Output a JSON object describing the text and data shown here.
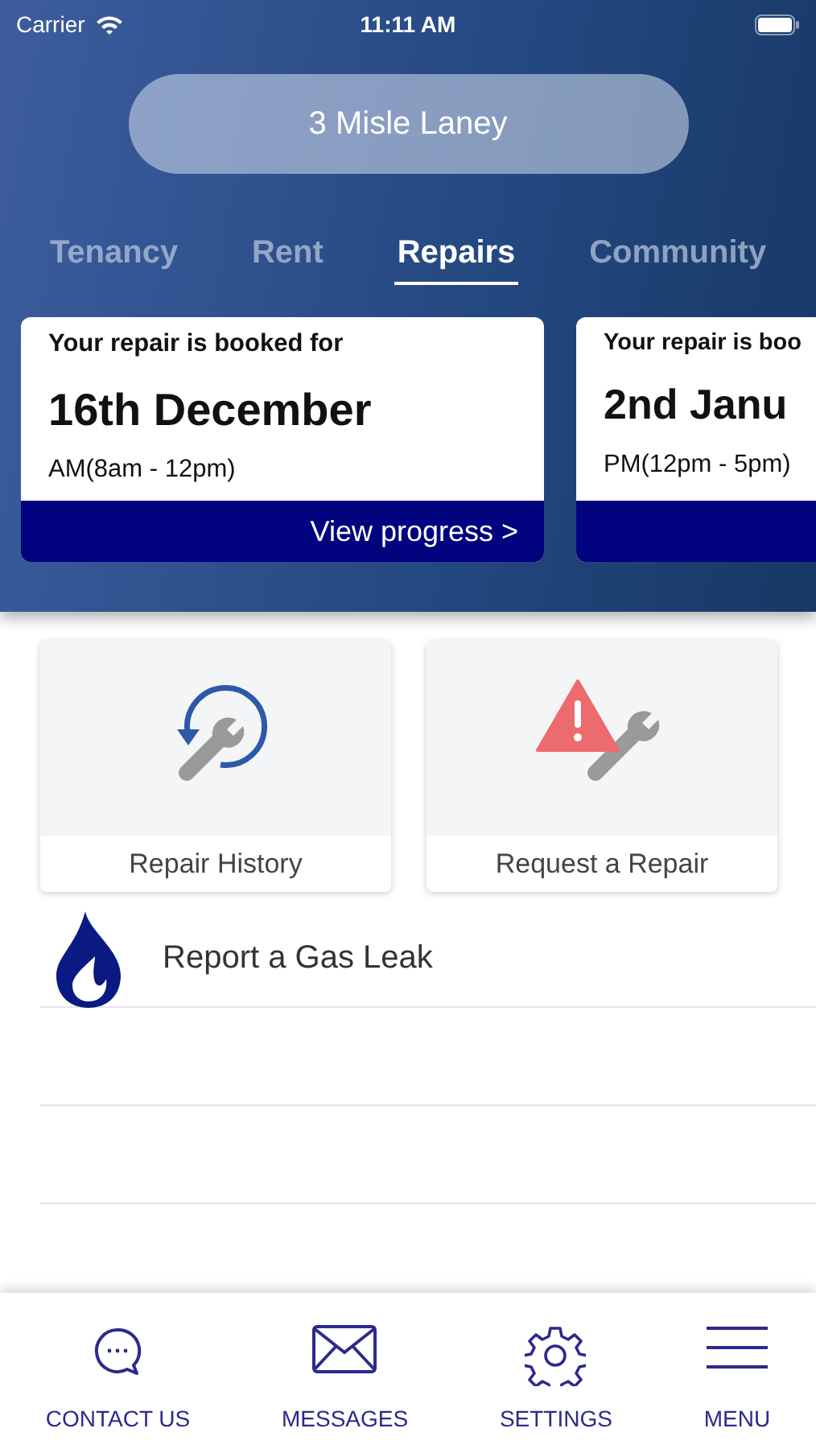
{
  "status_bar": {
    "carrier": "Carrier",
    "time": "11:11 AM"
  },
  "address": "3 Misle Laney",
  "tabs": [
    {
      "label": "Tenancy",
      "selected": false
    },
    {
      "label": "Rent",
      "selected": false
    },
    {
      "label": "Repairs",
      "selected": true
    },
    {
      "label": "Community",
      "selected": false
    }
  ],
  "bookings": [
    {
      "heading": "Your repair is booked for",
      "date": "16th December",
      "slot": "AM(8am - 12pm)",
      "link": "View progress >"
    },
    {
      "heading": "Your repair is boo",
      "date": "2nd Janu",
      "slot": "PM(12pm - 5pm)"
    }
  ],
  "tiles": [
    {
      "kind": "history",
      "label": "Repair History"
    },
    {
      "kind": "request",
      "label": "Request a Repair"
    }
  ],
  "list_items": [
    {
      "kind": "gas",
      "label": "Report a Gas Leak"
    }
  ],
  "nav": [
    {
      "kind": "chat",
      "label": "CONTACT US"
    },
    {
      "kind": "mail",
      "label": "MESSAGES"
    },
    {
      "kind": "gear",
      "label": "SETTINGS"
    },
    {
      "kind": "menu",
      "label": "MENU"
    }
  ]
}
